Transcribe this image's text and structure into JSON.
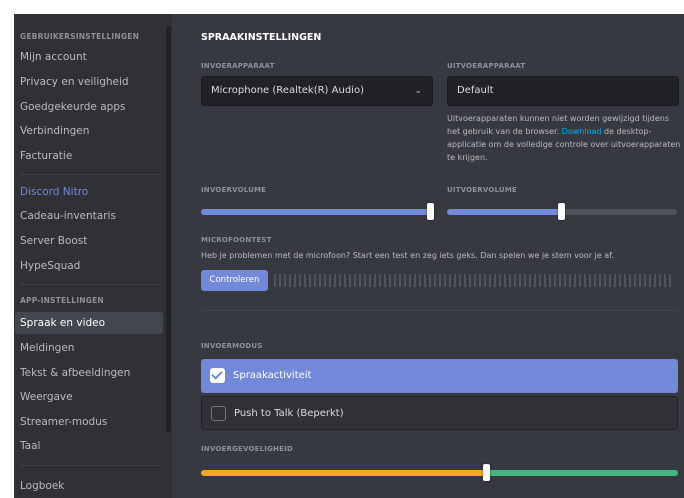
{
  "sidebar": {
    "user_settings_header": "GEBRUIKERSINSTELLINGEN",
    "user_items": [
      "Mijn account",
      "Privacy en veiligheid",
      "Goedgekeurde apps",
      "Verbindingen",
      "Facturatie"
    ],
    "nitro_items": [
      "Discord Nitro",
      "Cadeau-inventaris",
      "Server Boost",
      "HypeSquad"
    ],
    "app_settings_header": "APP-INSTELLINGEN",
    "app_items": [
      "Spraak en video",
      "Meldingen",
      "Tekst & afbeeldingen",
      "Weergave",
      "Streamer-modus",
      "Taal"
    ],
    "selected": "Spraak en video",
    "log_item": "Logboek"
  },
  "voice": {
    "title": "SPRAAKINSTELLINGEN",
    "input_device_label": "INVOERAPPARAAT",
    "input_device_value": "Microphone (Realtek(R) Audio)",
    "output_device_label": "UITVOERAPPARAAT",
    "output_device_value": "Default",
    "output_note_before": "Uitvoerapparaten kunnen niet worden gewijzigd tijdens het gebruik van de browser. ",
    "output_note_link": "Download",
    "output_note_after": " de desktop-applicatie om de volledige controle over uitvoerapparaten te krijgen.",
    "input_volume_label": "INVOERVOLUME",
    "input_volume_value": 1.0,
    "output_volume_label": "UITVOERVOLUME",
    "output_volume_value": 0.5,
    "mic_test_label": "MICROFOONTEST",
    "mic_test_text": "Heb je problemen met de microfoon? Start een test en zeg iets geks. Dan spelen we je stem voor je af.",
    "mic_test_button": "Controleren",
    "input_mode_label": "INVOERMODUS",
    "input_modes": [
      {
        "label": "Spraakactiviteit",
        "selected": true
      },
      {
        "label": "Push to Talk (Beperkt)",
        "selected": false
      }
    ],
    "sensitivity_label": "INVOERGEVOELIGHEID",
    "sensitivity_value": 0.6
  },
  "colors": {
    "accent": "#7289da",
    "link": "#00b0f4",
    "sensitivity_low": "#faa61a",
    "sensitivity_high": "#43b581"
  }
}
